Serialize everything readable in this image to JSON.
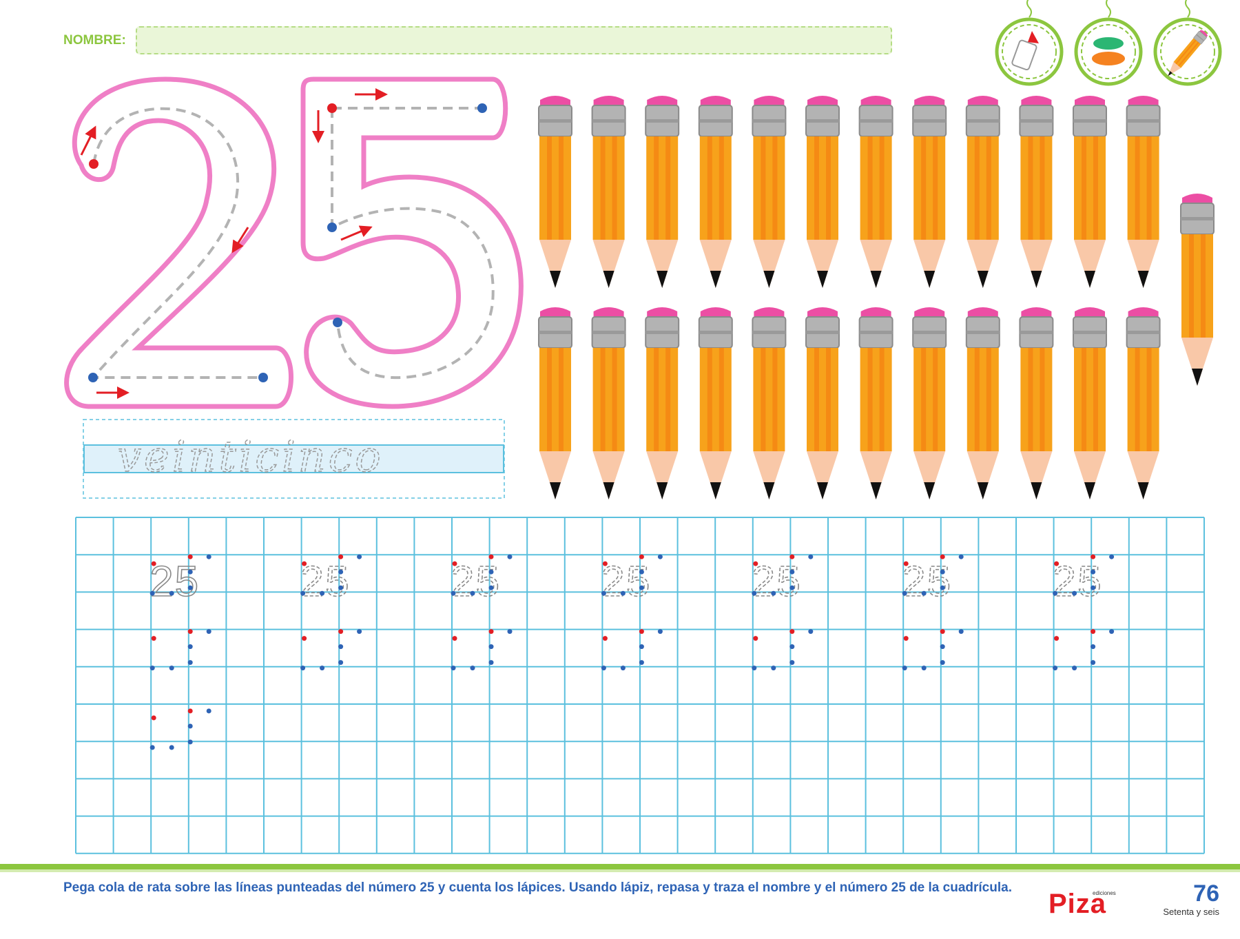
{
  "header": {
    "name_label": "NOMBRE:",
    "name_value": ""
  },
  "materials": [
    {
      "icon": "glue-bottle-icon"
    },
    {
      "icon": "yarn-icon"
    },
    {
      "icon": "pencil-icon"
    }
  ],
  "number": {
    "digits": "25",
    "word": "veinticinco"
  },
  "pencils": {
    "count": 25
  },
  "grid": {
    "practice_number": "25",
    "rows": 9,
    "cols": 30
  },
  "footer": {
    "instruction": "Pega cola de rata sobre las líneas punteadas del número 25 y cuenta los lápices. Usando lápiz, repasa y traza el nombre y el número 25 de la cuadrícula.",
    "publisher_small": "ediciones",
    "publisher": "Piza",
    "page_number": "76",
    "page_words": "Setenta y seis"
  },
  "colors": {
    "green": "#8cc63f",
    "pink": "#ef7fc6",
    "grid": "#5bc0de",
    "blue": "#2e63b5",
    "pencil": "#f7a21b"
  }
}
